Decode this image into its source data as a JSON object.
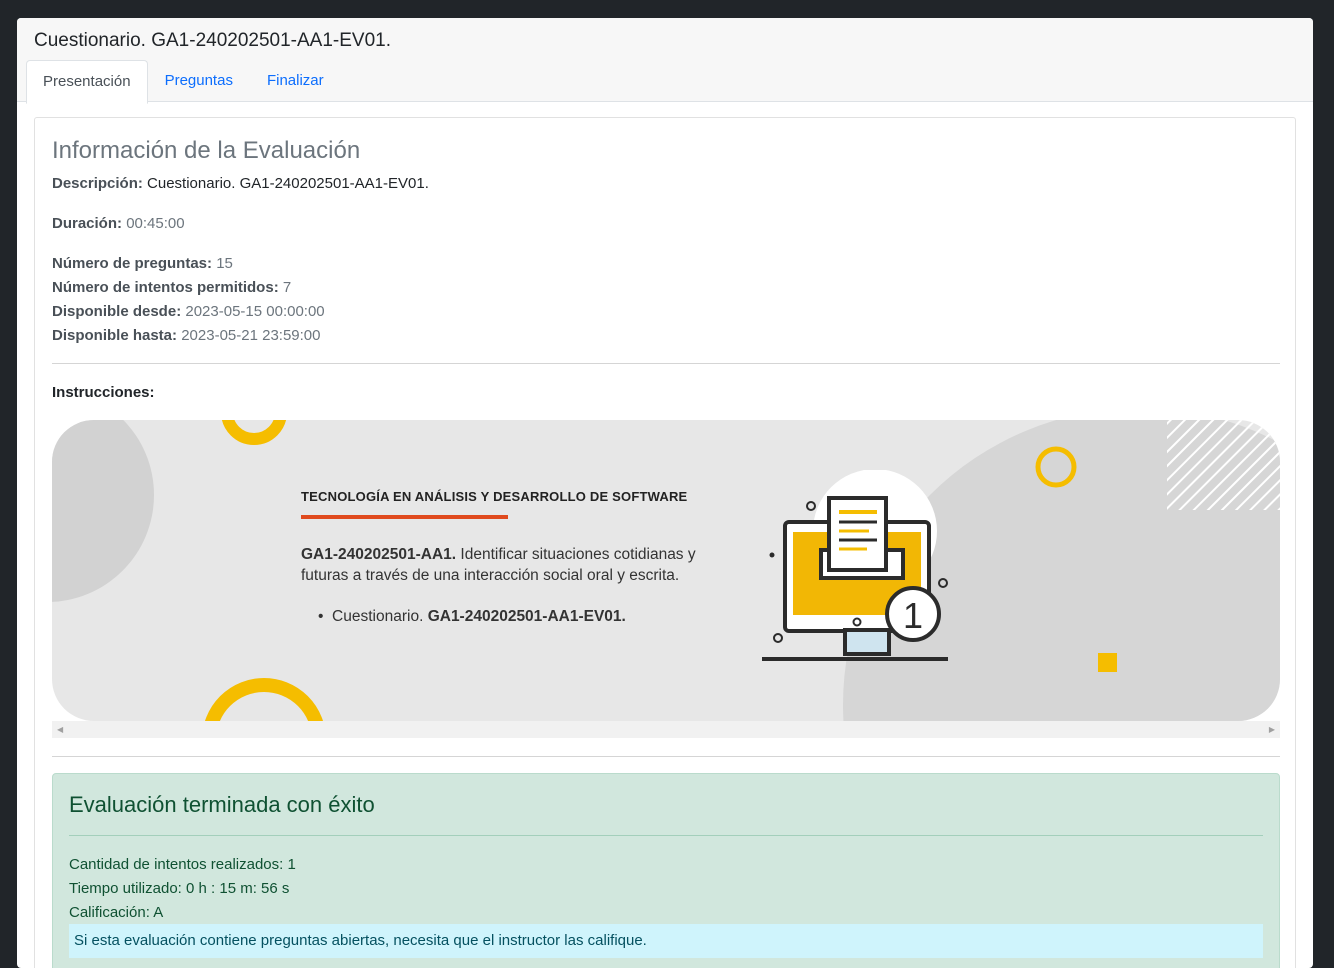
{
  "card": {
    "title": "Cuestionario. GA1-240202501-AA1-EV01.",
    "tabs": [
      {
        "label": "Presentación",
        "active": true
      },
      {
        "label": "Preguntas",
        "active": false
      },
      {
        "label": "Finalizar",
        "active": false
      }
    ]
  },
  "info": {
    "title": "Información de la Evaluación",
    "descripcion_label": "Descripción:",
    "descripcion_value": "Cuestionario. GA1-240202501-AA1-EV01.",
    "duracion_label": "Duración:",
    "duracion_value": "00:45:00",
    "num_preguntas_label": "Número de preguntas:",
    "num_preguntas_value": "15",
    "num_intentos_label": "Número de intentos permitidos:",
    "num_intentos_value": "7",
    "desde_label": "Disponible desde:",
    "desde_value": "2023-05-15 00:00:00",
    "hasta_label": "Disponible hasta:",
    "hasta_value": "2023-05-21 23:59:00"
  },
  "instructions": {
    "label": "Instrucciones:",
    "banner_title": "TECNOLOGÍA EN ANÁLISIS Y DESARROLLO DE SOFTWARE",
    "code": "GA1-240202501-AA1.",
    "description": "Identificar situaciones cotidianas y futuras a través de una interacción social oral y escrita.",
    "bullet_prefix": "Cuestionario.",
    "bullet_code": "GA1-240202501-AA1-EV01.",
    "badge_number": "1"
  },
  "result": {
    "title": "Evaluación terminada con éxito",
    "intentos": "Cantidad de intentos realizados: 1",
    "tiempo": "Tiempo utilizado: 0 h : 15 m: 56 s",
    "calificacion": "Calificación: A",
    "note": "Si esta evaluación contiene preguntas abiertas, necesita que el instructor las califique."
  },
  "colors": {
    "accent_yellow": "#f5bd00",
    "accent_red": "#e04a1e",
    "link_blue": "#0d6efd",
    "success_bg": "#d1e7dd",
    "info_bg": "#cff4fc"
  }
}
